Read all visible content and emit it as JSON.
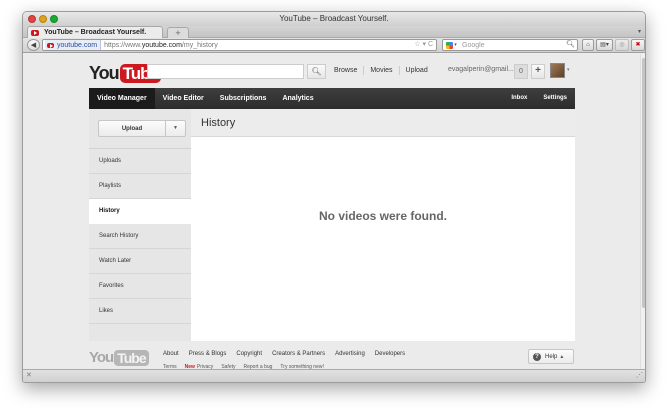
{
  "window": {
    "title": "YouTube – Broadcast Yourself."
  },
  "tabs": [
    {
      "label": "YouTube – Broadcast Yourself."
    }
  ],
  "new_tab_label": "+",
  "navbar": {
    "identity": "youtube.com",
    "url_prefix": "https://www.",
    "url_domain": "youtube.com",
    "url_path": "/my_history",
    "url_right": "☆ ▾ C",
    "search_placeholder": "Google",
    "search_engine_caret": "▾"
  },
  "header": {
    "logo_you": "You",
    "logo_tube": "Tube",
    "search_value": "",
    "nav": [
      "Browse",
      "Movies",
      "Upload"
    ],
    "user": "evagalperin@gmail...",
    "notifications": "0",
    "plus": "+"
  },
  "darkbar": {
    "left": [
      "Video Manager",
      "Video Editor",
      "Subscriptions",
      "Analytics"
    ],
    "right": [
      "Inbox",
      "Settings"
    ]
  },
  "sidebar": {
    "upload_label": "Upload",
    "items": [
      "Uploads",
      "Playlists",
      "History",
      "Search History",
      "Watch Later",
      "Favorites",
      "Likes"
    ]
  },
  "main": {
    "title": "History",
    "empty_message": "No videos were found."
  },
  "footer": {
    "links": [
      "About",
      "Press & Blogs",
      "Copyright",
      "Creators & Partners",
      "Advertising",
      "Developers"
    ],
    "sub_new": "New",
    "sub_links": [
      "Terms",
      "Privacy",
      "Safety",
      "Report a bug",
      "Try something new!"
    ],
    "help_label": "Help"
  },
  "colors": {
    "brand": "#cc181e",
    "darkbar": "#2c2c2c"
  }
}
